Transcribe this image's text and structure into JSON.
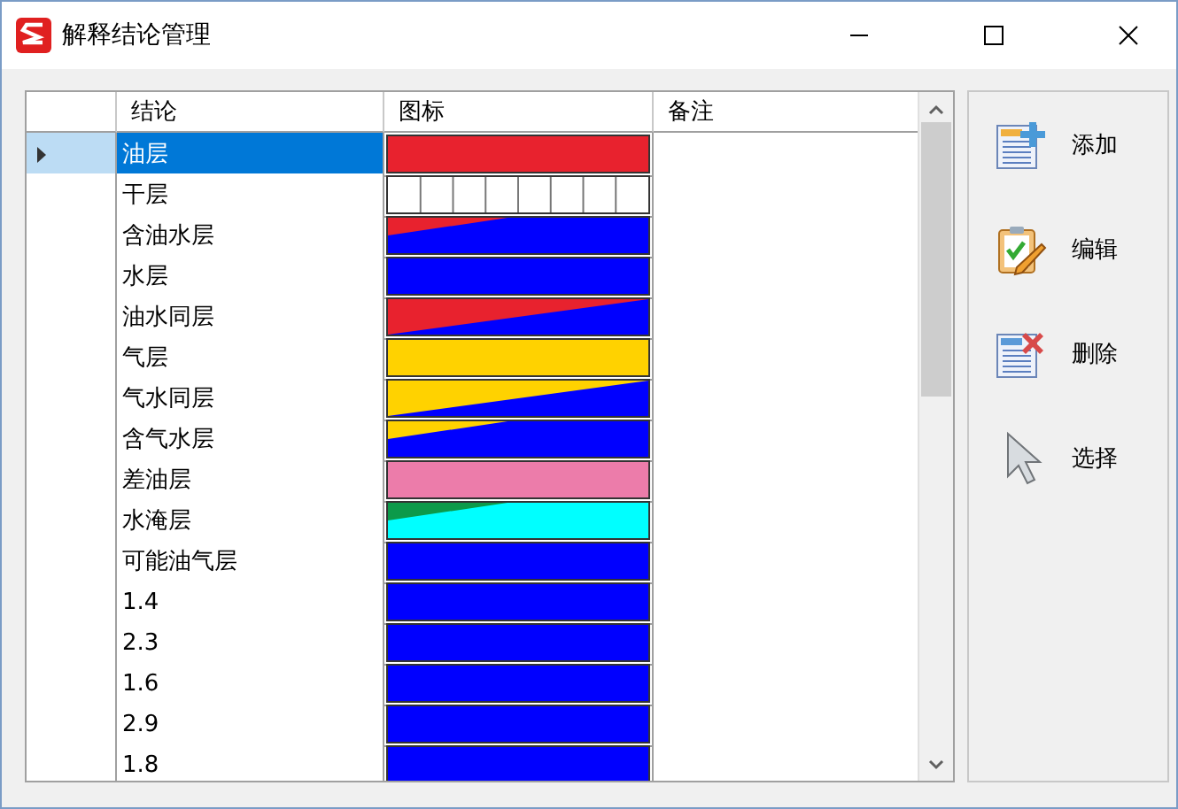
{
  "window": {
    "title": "解释结论管理"
  },
  "table": {
    "columns": [
      "结论",
      "图标",
      "备注"
    ],
    "rows": [
      {
        "conclusion": "油层",
        "selected": true,
        "swatch": {
          "kind": "solid",
          "color": "#e8222e"
        }
      },
      {
        "conclusion": "干层",
        "selected": false,
        "swatch": {
          "kind": "grid"
        }
      },
      {
        "conclusion": "含油水层",
        "selected": false,
        "swatch": {
          "kind": "wedge",
          "layers": [
            {
              "color": "#0000ff"
            },
            {
              "color": "#e8222e"
            }
          ]
        }
      },
      {
        "conclusion": "水层",
        "selected": false,
        "swatch": {
          "kind": "solid",
          "color": "#0000ff"
        }
      },
      {
        "conclusion": "油水同层",
        "selected": false,
        "swatch": {
          "kind": "diagonal",
          "layers": [
            {
              "color": "#0000ff"
            },
            {
              "color": "#e8222e"
            }
          ]
        }
      },
      {
        "conclusion": "气层",
        "selected": false,
        "swatch": {
          "kind": "solid",
          "color": "#ffd200"
        }
      },
      {
        "conclusion": "气水同层",
        "selected": false,
        "swatch": {
          "kind": "diagonal",
          "layers": [
            {
              "color": "#0000ff"
            },
            {
              "color": "#ffd200"
            }
          ]
        }
      },
      {
        "conclusion": "含气水层",
        "selected": false,
        "swatch": {
          "kind": "wedge",
          "layers": [
            {
              "color": "#0000ff"
            },
            {
              "color": "#ffd200"
            }
          ]
        }
      },
      {
        "conclusion": "差油层",
        "selected": false,
        "swatch": {
          "kind": "solid",
          "color": "#ec7caa"
        }
      },
      {
        "conclusion": "水淹层",
        "selected": false,
        "swatch": {
          "kind": "wedge",
          "layers": [
            {
              "color": "#00ffff"
            },
            {
              "color": "#0c9a4a"
            }
          ]
        }
      },
      {
        "conclusion": "可能油气层",
        "selected": false,
        "swatch": {
          "kind": "solid",
          "color": "#0000ff"
        }
      },
      {
        "conclusion": "1.4",
        "selected": false,
        "swatch": {
          "kind": "solid",
          "color": "#0000ff"
        }
      },
      {
        "conclusion": "2.3",
        "selected": false,
        "swatch": {
          "kind": "solid",
          "color": "#0000ff"
        }
      },
      {
        "conclusion": "1.6",
        "selected": false,
        "swatch": {
          "kind": "solid",
          "color": "#0000ff"
        }
      },
      {
        "conclusion": "2.9",
        "selected": false,
        "swatch": {
          "kind": "solid",
          "color": "#0000ff"
        }
      },
      {
        "conclusion": "1.8",
        "selected": false,
        "swatch": {
          "kind": "solid",
          "color": "#0000ff"
        }
      }
    ]
  },
  "actions": [
    {
      "kind": "add",
      "label": "添加"
    },
    {
      "kind": "edit",
      "label": "编辑"
    },
    {
      "kind": "delete",
      "label": "删除"
    },
    {
      "kind": "select",
      "label": "选择"
    }
  ]
}
